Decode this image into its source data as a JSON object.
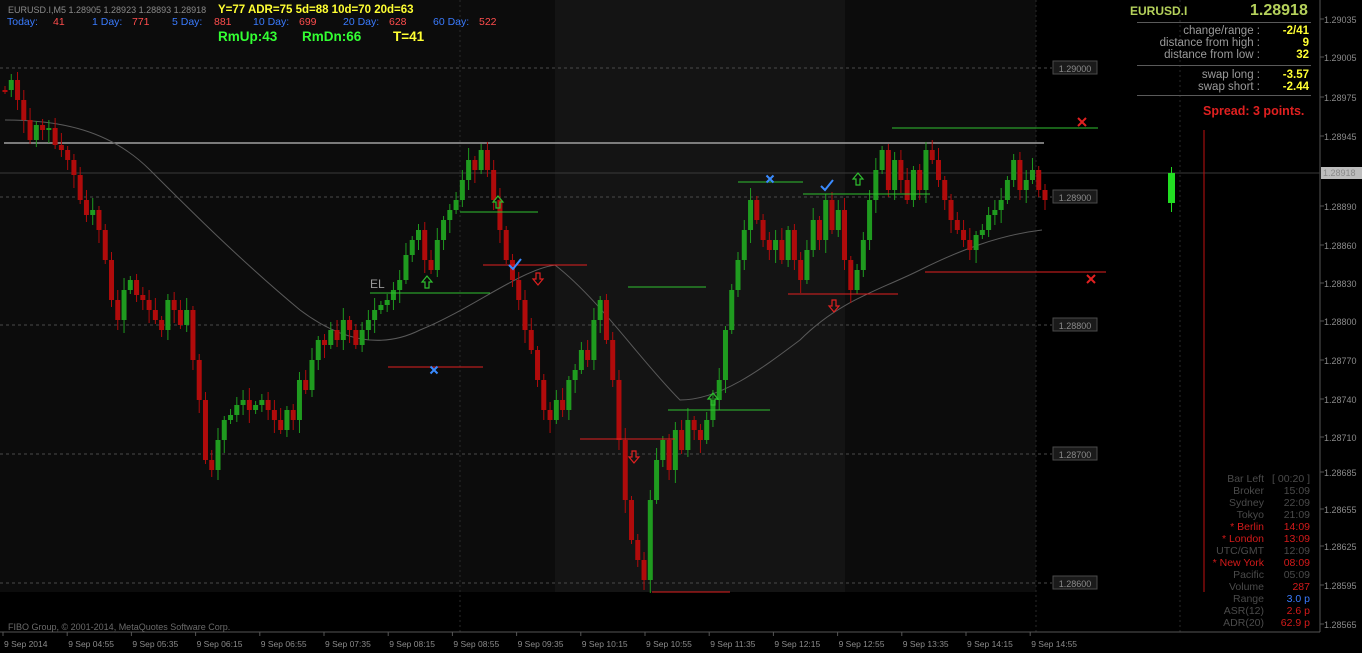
{
  "window": {
    "symbol_line": "EURUSD.I,M5  1.28905 1.28923 1.28893 1.28918",
    "watermark": "FIBO Group, © 2001-2014, MetaQuotes Software Corp."
  },
  "range_stats": [
    {
      "label": "Today:",
      "value": "41",
      "label_color": "#3a7bff",
      "value_color": "#ff4d4d"
    },
    {
      "label": "1 Day:",
      "value": "771",
      "label_color": "#3a7bff",
      "value_color": "#ff4d4d"
    },
    {
      "label": "5 Day:",
      "value": "881",
      "label_color": "#3a7bff",
      "value_color": "#ff4d4d"
    },
    {
      "label": "10 Day:",
      "value": "699",
      "label_color": "#3a7bff",
      "value_color": "#ff4d4d"
    },
    {
      "label": "20 Day:",
      "value": "628",
      "label_color": "#3a7bff",
      "value_color": "#ff4d4d"
    },
    {
      "label": "60 Day:",
      "value": "522",
      "label_color": "#3a7bff",
      "value_color": "#ff4d4d"
    }
  ],
  "adr_header": "Y=77  ADR=75  5d=88  10d=70  20d=63",
  "rm_info": {
    "up": "RmUp:43",
    "down": "RmDn:66",
    "total": "T=41"
  },
  "info_panel": {
    "symbol": "EURUSD.I",
    "price": "1.28918",
    "rows1": [
      {
        "label": "change/range :",
        "value": "-2/41"
      },
      {
        "label": "distance from high :",
        "value": "9"
      },
      {
        "label": "distance from low :",
        "value": "32"
      }
    ],
    "rows2": [
      {
        "label": "swap long :",
        "value": "-3.57"
      },
      {
        "label": "swap short :",
        "value": "-2.44"
      }
    ],
    "spread": "Spread: 3 points."
  },
  "clock_panel": {
    "rows": [
      {
        "label": "Bar Left",
        "value": "[ 00:20 ]",
        "color": "#4a4a4a"
      },
      {
        "label": "Broker",
        "value": "15:09",
        "color": "#4a4a4a"
      },
      {
        "label": "Sydney",
        "value": "22:09",
        "color": "#4a4a4a"
      },
      {
        "label": "Tokyo",
        "value": "21:09",
        "color": "#4a4a4a"
      },
      {
        "label": "* Berlin",
        "value": "14:09",
        "color": "#d41a1a"
      },
      {
        "label": "* London",
        "value": "13:09",
        "color": "#d41a1a"
      },
      {
        "label": "UTC/GMT",
        "value": "12:09",
        "color": "#4a4a4a"
      },
      {
        "label": "* New York",
        "value": "08:09",
        "color": "#d41a1a"
      },
      {
        "label": "Pacific",
        "value": "05:09",
        "color": "#4a4a4a"
      },
      {
        "label": "Volume",
        "value": "287",
        "color": "#4a4a4a",
        "value_color": "#d41a1a"
      },
      {
        "label": "Range",
        "value": "3.0 p",
        "color": "#4a4a4a",
        "value_color": "#3a7bff"
      },
      {
        "label": "ASR(12)",
        "value": "2.6 p",
        "color": "#4a4a4a",
        "value_color": "#d41a1a"
      },
      {
        "label": "ADR(20)",
        "value": "62.9 p",
        "color": "#4a4a4a",
        "value_color": "#d41a1a"
      }
    ]
  },
  "price_axis": {
    "ticks": [
      "1.29035",
      "1.29005",
      "1.28975",
      "1.28945",
      "1.28890",
      "1.28860",
      "1.28830",
      "1.28800",
      "1.28770",
      "1.28740",
      "1.28710",
      "1.28685",
      "1.28655",
      "1.28625",
      "1.28595",
      "1.28565"
    ],
    "current": "1.28918"
  },
  "level_labels": [
    "1.29000",
    "1.28900",
    "1.28800",
    "1.28700",
    "1.28600"
  ],
  "time_axis": [
    "9 Sep 2014",
    "9 Sep 04:55",
    "9 Sep 05:35",
    "9 Sep 06:15",
    "9 Sep 06:55",
    "9 Sep 07:35",
    "9 Sep 08:15",
    "9 Sep 08:55",
    "9 Sep 09:35",
    "9 Sep 10:15",
    "9 Sep 10:55",
    "9 Sep 11:35",
    "9 Sep 12:15",
    "9 Sep 12:55",
    "9 Sep 13:35",
    "9 Sep 14:15",
    "9 Sep 14:55"
  ],
  "el_label": "EL",
  "colors": {
    "bull": "#1f9b1f",
    "bear": "#b00b0b",
    "up_arrow": "#2fbf2f",
    "down_arrow": "#e02020",
    "check": "#3a8bff",
    "cross_blue": "#3a8bff",
    "cross_red": "#e02020"
  }
}
